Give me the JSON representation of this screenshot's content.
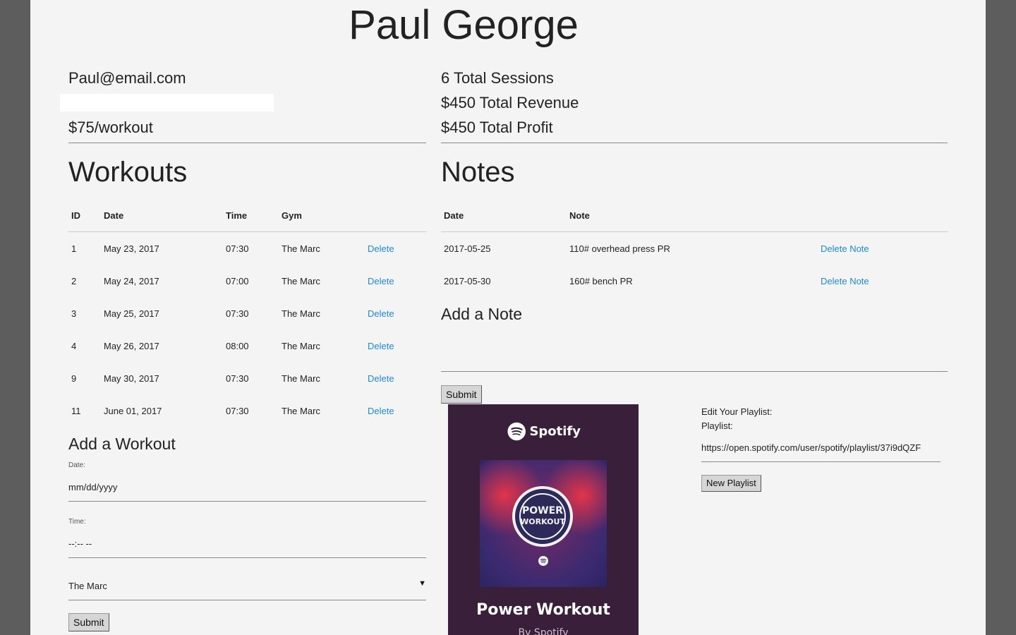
{
  "client": {
    "name": "Paul George",
    "email": "Paul@email.com",
    "rate": "$75/workout"
  },
  "stats": {
    "sessions": "6 Total Sessions",
    "revenue": "$450 Total Revenue",
    "profit": "$450 Total Profit"
  },
  "workouts": {
    "heading": "Workouts",
    "columns": {
      "id": "ID",
      "date": "Date",
      "time": "Time",
      "gym": "Gym"
    },
    "delete_label": "Delete",
    "rows": [
      {
        "id": "1",
        "date": "May 23, 2017",
        "time": "07:30",
        "gym": "The Marc"
      },
      {
        "id": "2",
        "date": "May 24, 2017",
        "time": "07:00",
        "gym": "The Marc"
      },
      {
        "id": "3",
        "date": "May 25, 2017",
        "time": "07:30",
        "gym": "The Marc"
      },
      {
        "id": "4",
        "date": "May 26, 2017",
        "time": "08:00",
        "gym": "The Marc"
      },
      {
        "id": "9",
        "date": "May 30, 2017",
        "time": "07:30",
        "gym": "The Marc"
      },
      {
        "id": "11",
        "date": "June 01, 2017",
        "time": "07:30",
        "gym": "The Marc"
      }
    ]
  },
  "add_workout": {
    "heading": "Add a Workout",
    "date_label": "Date:",
    "date_placeholder": "mm/dd/yyyy",
    "time_label": "Time:",
    "time_placeholder": "--:-- --",
    "gym_selected": "The Marc",
    "dropdown_arrow": "▼",
    "submit_label": "Submit"
  },
  "notes": {
    "heading": "Notes",
    "columns": {
      "date": "Date",
      "note": "Note"
    },
    "delete_label": "Delete Note",
    "rows": [
      {
        "date": "2017-05-25",
        "note": "110# overhead press PR"
      },
      {
        "date": "2017-05-30",
        "note": "160# bench PR"
      }
    ]
  },
  "add_note": {
    "heading": "Add a Note",
    "submit_label": "Submit"
  },
  "spotify": {
    "brand": "Spotify",
    "badge_line1": "POWER",
    "badge_line2": "WORKOUT",
    "playlist_title": "Power Workout",
    "byline": "By Spotify"
  },
  "playlist": {
    "edit_label": "Edit Your Playlist:",
    "playlist_label": "Playlist:",
    "url": "https://open.spotify.com/user/spotify/playlist/37i9dQZF",
    "button_label": "New Playlist"
  },
  "colors": {
    "page_bg": "#f4f4f4",
    "outer_bg": "#5d5d5d",
    "link": "#1e8ad6",
    "spotify_card": "#3a1f3b"
  }
}
